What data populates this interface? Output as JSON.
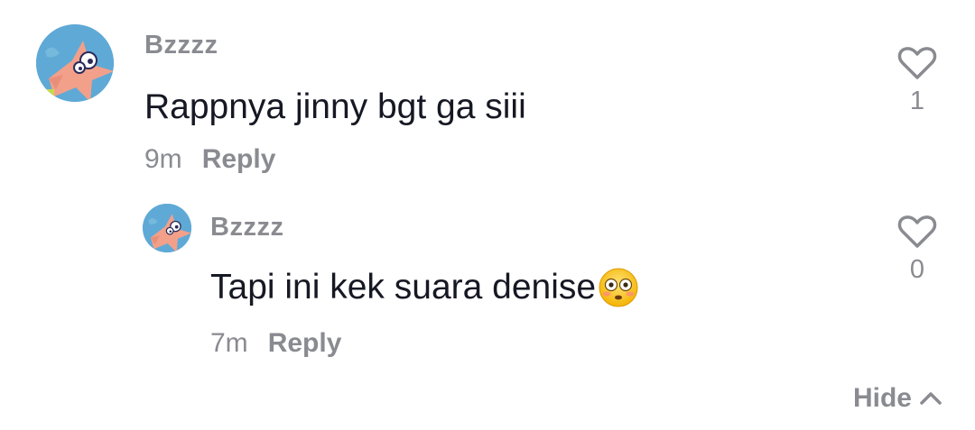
{
  "comments": [
    {
      "username": "Bzzzz",
      "text": "Rappnya jinny bgt ga siii",
      "time": "9m",
      "reply_label": "Reply",
      "like_count": "1",
      "avatar_icon": "patrick-star-avatar"
    },
    {
      "username": "Bzzzz",
      "text": "Tapi ini kek suara denise",
      "emoji": "flushed-face-emoji",
      "time": "7m",
      "reply_label": "Reply",
      "like_count": "0",
      "avatar_icon": "patrick-star-avatar"
    }
  ],
  "hide_label": "Hide",
  "colors": {
    "primary_text": "#161823",
    "secondary_text": "#8a8b91"
  }
}
